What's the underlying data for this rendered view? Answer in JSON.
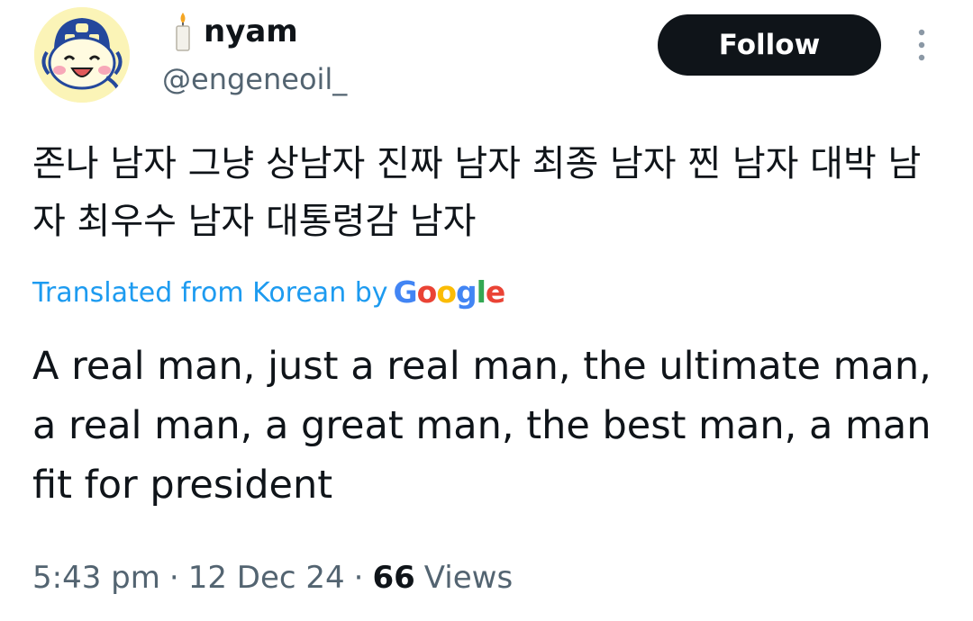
{
  "user": {
    "display_name": "nyam",
    "name_emoji": "candle-icon",
    "handle": "@engeneoil_",
    "avatar": "tamagotchi-character-avatar"
  },
  "header": {
    "follow_label": "Follow",
    "more_icon": "more-vertical-icon"
  },
  "tweet": {
    "original_text": "존나 남자 그냥 상남자 진짜 남자 최종 남자 찐 남자 대박 남자 최우수 남자 대통령감 남자",
    "translation": {
      "label": "Translated from Korean by",
      "provider_letters": [
        "G",
        "o",
        "o",
        "g",
        "l",
        "e"
      ],
      "provider_colors": [
        "#4285F4",
        "#EA4335",
        "#FBBC05",
        "#4285F4",
        "#34A853",
        "#EA4335"
      ],
      "text": "A real man, just a real man, the ultimate man, a real man, a great man, the best man, a man fit for president"
    }
  },
  "meta": {
    "time": "5:43 pm",
    "separator": "·",
    "date": "12 Dec 24",
    "views_count": "66",
    "views_label": "Views"
  },
  "colors": {
    "link": "#1d9bf0",
    "secondary_text": "#536471",
    "primary_text": "#0f1419",
    "follow_button_bg": "#0f1419"
  }
}
